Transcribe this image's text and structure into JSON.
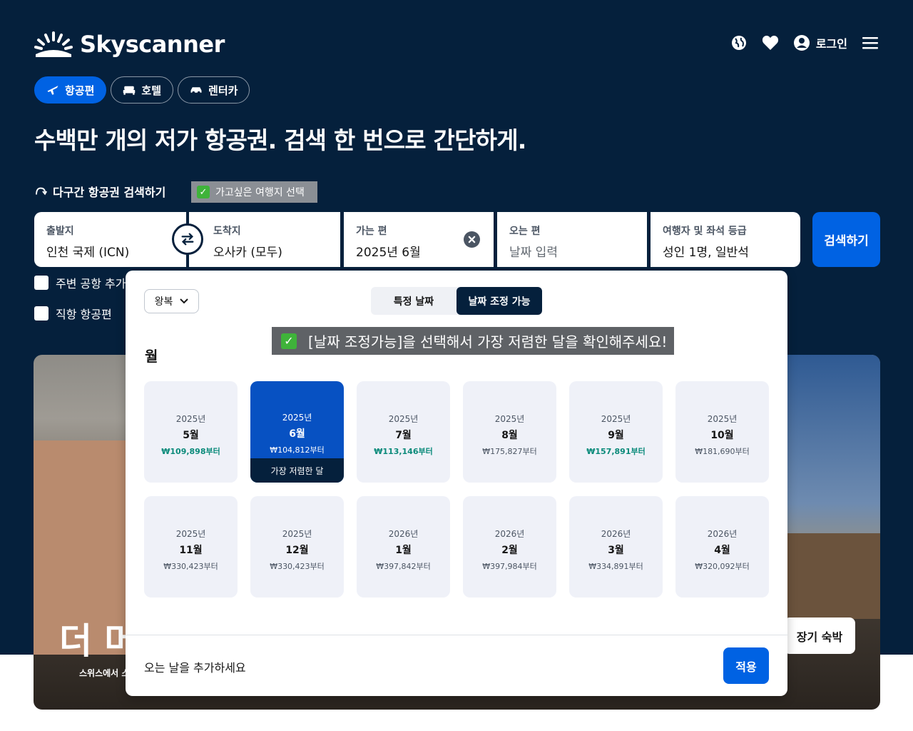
{
  "header": {
    "logo_text": "Skyscanner",
    "login_label": "로그인",
    "icons": [
      "globe-icon",
      "heart-icon",
      "account-icon",
      "menu-icon"
    ]
  },
  "tabs": [
    {
      "label": "항공편",
      "icon": "plane-icon",
      "active": true
    },
    {
      "label": "호텔",
      "icon": "bed-icon",
      "active": false
    },
    {
      "label": "렌터카",
      "icon": "car-icon",
      "active": false
    }
  ],
  "headline": "수백만 개의 저가 항공권. 검색 한 번으로 간단하게.",
  "multicity_label": "다구간 항공권 검색하기",
  "annotation_top": "가고싶은 여행지 선택",
  "search": {
    "origin": {
      "label": "출발지",
      "value": "인천 국제 (ICN)"
    },
    "destination": {
      "label": "도착지",
      "value": "오사카 (모두)"
    },
    "depart": {
      "label": "가는 편",
      "value": "2025년 6월"
    },
    "return": {
      "label": "오는 편",
      "placeholder": "날짜 입력"
    },
    "travellers": {
      "label": "여행자 및 좌석 등급",
      "value": "성인 1명, 일반석"
    },
    "search_button": "검색하기"
  },
  "checkboxes": {
    "nearby": "주변 공항 추가",
    "direct": "직항 항공편"
  },
  "banner": {
    "title": "더 머",
    "subtitle": "스위스에서 스",
    "long_stay": "장기 숙박"
  },
  "popup": {
    "trip_type": "왕복",
    "seg_specific": "특정 날짜",
    "seg_flexible": "날짜 조정 가능",
    "annotation": "[날짜 조정가능]을 선택해서 가장 저렴한 달을 확인해주세요!",
    "heading": "월",
    "months": [
      {
        "year": "2025년",
        "month": "5월",
        "price": "₩109,898부터",
        "cheap": true
      },
      {
        "year": "2025년",
        "month": "6월",
        "price": "₩104,812부터",
        "cheap": true,
        "selected": true,
        "badge": "가장 저렴한 달"
      },
      {
        "year": "2025년",
        "month": "7월",
        "price": "₩113,146부터",
        "cheap": true
      },
      {
        "year": "2025년",
        "month": "8월",
        "price": "₩175,827부터",
        "cheap": false
      },
      {
        "year": "2025년",
        "month": "9월",
        "price": "₩157,891부터",
        "cheap": true
      },
      {
        "year": "2025년",
        "month": "10월",
        "price": "₩181,690부터",
        "cheap": false
      },
      {
        "year": "2025년",
        "month": "11월",
        "price": "₩330,423부터",
        "cheap": false
      },
      {
        "year": "2025년",
        "month": "12월",
        "price": "₩330,423부터",
        "cheap": false
      },
      {
        "year": "2026년",
        "month": "1월",
        "price": "₩397,842부터",
        "cheap": false
      },
      {
        "year": "2026년",
        "month": "2월",
        "price": "₩397,984부터",
        "cheap": false
      },
      {
        "year": "2026년",
        "month": "3월",
        "price": "₩334,891부터",
        "cheap": false
      },
      {
        "year": "2026년",
        "month": "4월",
        "price": "₩320,092부터",
        "cheap": false
      }
    ],
    "footer_text": "오는 날을 추가하세요",
    "apply_button": "적용"
  },
  "colors": {
    "navy": "#05203c",
    "brand_blue": "#0062e3",
    "selected_month": "#0751c2",
    "cheap_price": "#0a8a7a"
  }
}
